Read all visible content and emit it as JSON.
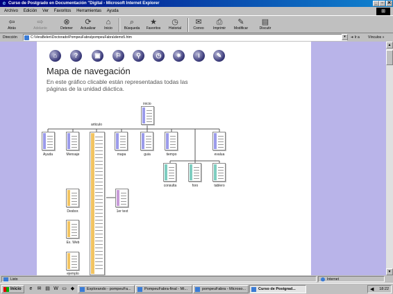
{
  "window": {
    "title": "Curso de Postgrado en Documentación \"Digital - Microsoft Internet Explorer",
    "controls": [
      "_",
      "▫",
      "✕"
    ]
  },
  "menu": [
    {
      "label": "Archivo"
    },
    {
      "label": "Edición"
    },
    {
      "label": "Ver"
    },
    {
      "label": "Favoritos"
    },
    {
      "label": "Herramientas"
    },
    {
      "label": "Ayuda"
    }
  ],
  "toolbar": {
    "back": "Atrás",
    "forward": "Adelante",
    "stop": "Detener",
    "refresh": "Actualizar",
    "home": "Inicio",
    "search": "Búsqueda",
    "favorites": "Favoritos",
    "history": "Historial",
    "mail": "Correo",
    "print": "Imprimir",
    "edit": "Modificar",
    "discuss": "Discutir"
  },
  "address": {
    "label": "Dirección",
    "url": "C:\\VeraBelen\\Doctorado\\PompeuFabra\\pompeuFabra\\demo5.htm",
    "go": "Ir a",
    "links": "Vínculos »"
  },
  "content": {
    "nav_icons": [
      "home",
      "help",
      "lessons",
      "paths",
      "search",
      "clock",
      "bulb",
      "info",
      "notes"
    ],
    "title": "Mapa de navegación",
    "description": "En este gráfico clicable están representadas todas las páginas de la unidad diáctica.",
    "nodes": {
      "inicio": "inicio",
      "articulo": "articulo",
      "ayuda": "Ayuda",
      "mensaje": "Mensaje",
      "mapa": "mapa",
      "guia": "guia",
      "tiempo": "tiempo",
      "evalua": "evalua",
      "consulta": "consulta",
      "foro": "foro",
      "tablero": "tablero",
      "desbor": "Desbor.",
      "exweb": "Ex. Web",
      "ejemplo": "ejemplo",
      "tertext": "1er text"
    },
    "colors": {
      "blue": "#9b9bea",
      "yellow": "#f2c462",
      "teal": "#7ecdc0",
      "purple": "#c79bd8",
      "lilac_bg": "#b9b4e9"
    }
  },
  "status": {
    "text": "Listo",
    "zone": "Internet"
  },
  "taskbar": {
    "start": "Inicio",
    "tasks": [
      "Explorando - pompeuFa...",
      "PompeuFabra-final - Mi...",
      "pompeuFabra - Microso...",
      "Curso de Postgrad..."
    ],
    "clock": "18:22"
  }
}
